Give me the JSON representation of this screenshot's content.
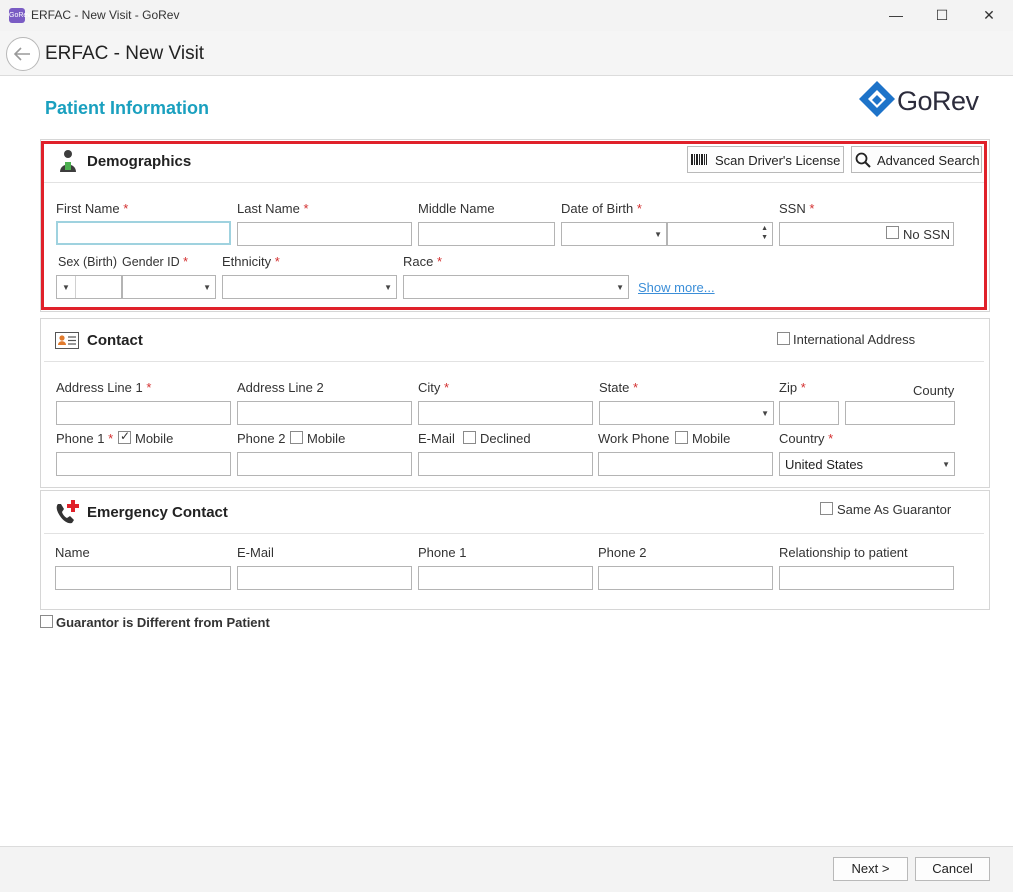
{
  "window": {
    "app_icon_text": "GoRev",
    "title": "ERFAC - New Visit - GoRev",
    "minimize": "—",
    "maximize": "☐",
    "close": "✕"
  },
  "header": {
    "title": "ERFAC - New Visit"
  },
  "page": {
    "section_title": "Patient Information",
    "brand": "GoRev"
  },
  "demographics": {
    "title": "Demographics",
    "scan_label": "Scan Driver's License",
    "search_label": "Advanced Search",
    "first_name": "First Name",
    "last_name": "Last Name",
    "middle_name": "Middle Name",
    "dob": "Date of Birth",
    "ssn": "SSN",
    "no_ssn": "No SSN",
    "sex_birth": "Sex (Birth)",
    "gender_id": "Gender ID",
    "ethnicity": "Ethnicity",
    "race": "Race",
    "show_more": "Show more...",
    "required_mark": "*"
  },
  "contact": {
    "title": "Contact",
    "international": "International Address",
    "address1": "Address Line 1",
    "address2": "Address Line 2",
    "city": "City",
    "state": "State",
    "zip": "Zip",
    "county": "County",
    "phone1": "Phone 1",
    "phone2": "Phone 2",
    "mobile": "Mobile",
    "email": "E-Mail",
    "declined": "Declined",
    "work_phone": "Work Phone",
    "country": "Country",
    "country_value": "United States"
  },
  "emergency": {
    "title": "Emergency Contact",
    "same_as_guarantor": "Same As Guarantor",
    "name": "Name",
    "email": "E-Mail",
    "phone1": "Phone 1",
    "phone2": "Phone 2",
    "relationship": "Relationship to patient"
  },
  "guarantor": {
    "label": "Guarantor is Different from Patient"
  },
  "footer": {
    "next": "Next >",
    "cancel": "Cancel"
  },
  "colors": {
    "accent": "#1aa0bf",
    "highlight": "#e0212a",
    "required": "#d32f2f",
    "brand": "#1d73c9"
  }
}
